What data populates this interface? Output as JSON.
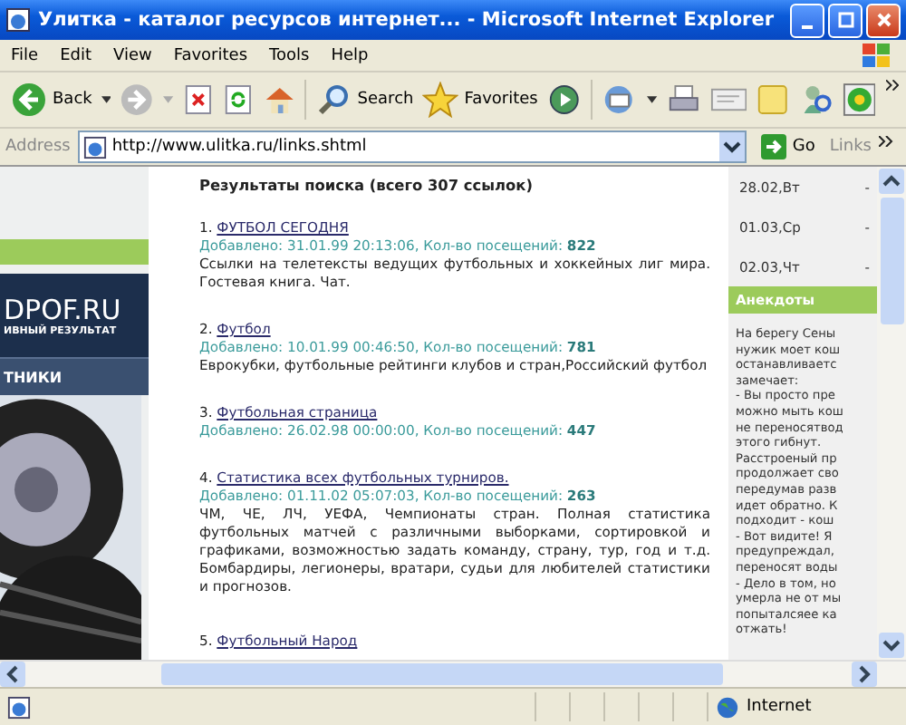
{
  "window": {
    "title": "Улитка - каталог ресурсов интернет... - Microsoft Internet Explorer"
  },
  "menu": [
    "File",
    "Edit",
    "View",
    "Favorites",
    "Tools",
    "Help"
  ],
  "toolbar": {
    "back_label": "Back",
    "search_label": "Search",
    "favorites_label": "Favorites"
  },
  "address": {
    "label": "Address",
    "value": "http://www.ulitka.ru/links.shtml",
    "go": "Go",
    "links": "Links"
  },
  "left_banner": {
    "logo": "DPOF.RU",
    "tagline": "ИВНЫЙ РЕЗУЛЬТАТ",
    "nav": "ТНИКИ"
  },
  "results": {
    "heading": "Результаты поиска (всего 307 ссылок)",
    "items": [
      {
        "number": "1.",
        "title": "ФУТБОЛ СЕГОДНЯ",
        "meta": "Добавлено: 31.01.99 20:13:06, Кол-во посещений: **822**",
        "description": "Ссылки на телетексты ведущих футбольных и хоккейных лиг мира. Гостевая книга. Чат."
      },
      {
        "number": "2.",
        "title": "Футбол",
        "meta": "Добавлено: 10.01.99 00:46:50, Кол-во посещений: **781**",
        "description": "Еврокубки, футбольные рейтинги клубов и стран,Российский футбол"
      },
      {
        "number": "3.",
        "title": "Футбольная страница",
        "meta": "Добавлено: 26.02.98 00:00:00, Кол-во посещений: **447**"
      },
      {
        "number": "4.",
        "title": "Статистика всех футбольных турниров.",
        "meta": "Добавлено: 01.11.02 05:07:03, Кол-во посещений: **263**",
        "description": "ЧМ, ЧЕ, ЛЧ, УЕФА, Чемпионаты стран. Полная статистика футбольных матчей с различными выборками, сортировкой и графиками, возможностью задать команду, страну, тур, год и т.д. Бомбардиры, легионеры, вратари, судьи для любителей статистики и прогнозов."
      },
      {
        "number": "5.",
        "title": "Футбольный Народ"
      }
    ]
  },
  "sidebar": {
    "dates": [
      {
        "date": "28.02,Вт",
        "value": "-"
      },
      {
        "date": "01.03,Ср",
        "value": "-"
      },
      {
        "date": "02.03,Чт",
        "value": "-"
      }
    ],
    "section_title": "Анекдоты",
    "joke_lines": [
      "На берегу Сены",
      "нужик моет кош",
      "останавливаетс",
      "замечает:",
      "- Вы просто пре",
      "можно мыть кош",
      "не переносятвод",
      "этого гибнут.",
      "Расстроеный пр",
      "продолжает сво",
      "передумав разв",
      "идет обратно. К",
      "подходит - кош",
      "- Вот видите! Я",
      "предупреждал,",
      "переносят воды",
      "- Дело в том, но",
      "умерла не от мы",
      "попыталсяее ка",
      "отжать!"
    ]
  },
  "status_bar": {
    "zone": "Internet"
  }
}
